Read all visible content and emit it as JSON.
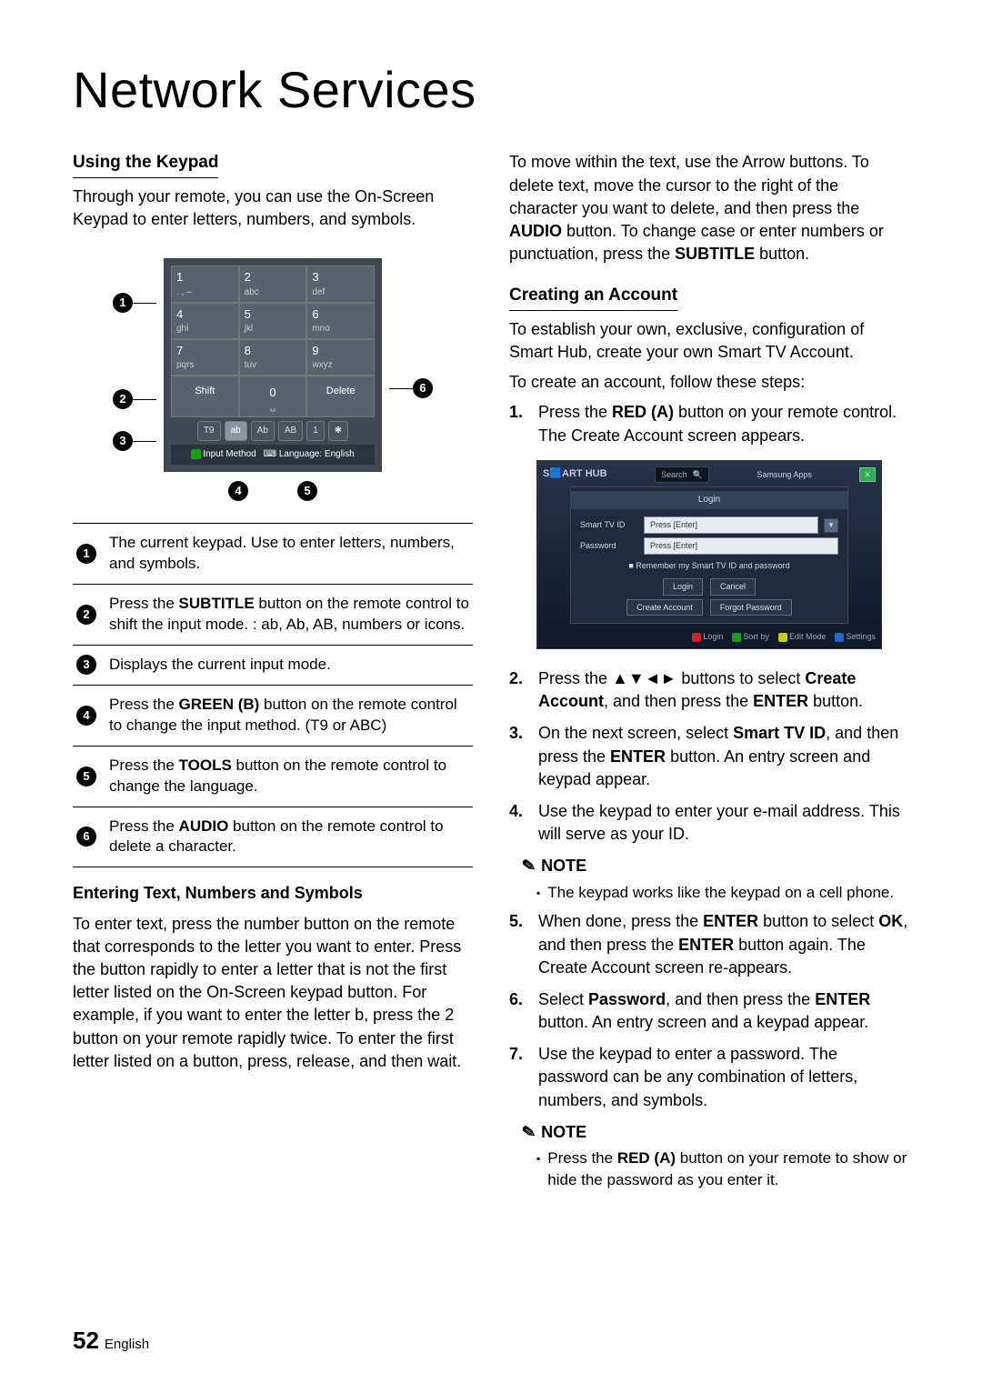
{
  "title": "Network Services",
  "left": {
    "h_using": "Using the Keypad",
    "p_using": "Through your remote, you can use the On-Screen Keypad to enter letters, numbers, and symbols.",
    "keypad": {
      "rows": [
        [
          {
            "n": "1",
            "l": ". , –"
          },
          {
            "n": "2",
            "l": "abc"
          },
          {
            "n": "3",
            "l": "def"
          }
        ],
        [
          {
            "n": "4",
            "l": "ghi"
          },
          {
            "n": "5",
            "l": "jkl"
          },
          {
            "n": "6",
            "l": "mno"
          }
        ],
        [
          {
            "n": "7",
            "l": "pqrs"
          },
          {
            "n": "8",
            "l": "tuv"
          },
          {
            "n": "9",
            "l": "wxyz"
          }
        ]
      ],
      "shift": "Shift",
      "zero": "0",
      "space": "␣",
      "delete": "Delete",
      "t9": "T9",
      "modes": [
        "ab",
        "Ab",
        "AB",
        "1",
        "✱"
      ],
      "footer_input": "Input Method",
      "footer_lang": "Language: English"
    },
    "legend": {
      "1": "The current keypad.\nUse to enter letters, numbers, and symbols.",
      "2_pre": "Press the ",
      "2_b": "SUBTITLE",
      "2_post": " button on the remote control to shift the input mode.\n: ab, Ab, AB, numbers or icons.",
      "3": "Displays the current input mode.",
      "4_pre": "Press the ",
      "4_b": "GREEN (B)",
      "4_post": " button on the remote control to change the input method. (T9 or ABC)",
      "5_pre": "Press the ",
      "5_b": "TOOLS",
      "5_post": " button on the remote control to change the language.",
      "6_pre": "Press the ",
      "6_b": "AUDIO",
      "6_post": " button on the remote control to delete a character."
    },
    "h_entering": "Entering Text, Numbers and Symbols",
    "p_entering": "To enter text, press the number button on the remote that corresponds to the letter you want to enter. Press the button rapidly to enter a letter that is not the first letter listed on the On-Screen keypad button. For example, if you want to enter the letter b, press the 2 button on your remote rapidly twice. To enter the first letter listed on a button, press, release, and then wait."
  },
  "right": {
    "p_move_pre": "To move within the text, use the Arrow buttons. To delete text, move the cursor to the right of the character you want to delete, and then press the ",
    "audio": "AUDIO",
    "p_move_mid": " button. To change case or enter numbers or punctuation, press the ",
    "subtitle": "SUBTITLE",
    "p_move_post": " button.",
    "h_creating": "Creating an Account",
    "p_est": "To establish your own, exclusive, configuration of Smart Hub, create your own Smart TV Account.",
    "p_follow": "To create an account, follow these steps:",
    "step1_pre": "Press the ",
    "step1_b": "RED (A)",
    "step1_post": " button on your remote control. The Create Account screen appears.",
    "ss": {
      "logo": "S🟦ART HUB",
      "search": "Search",
      "apps": "Samsung Apps",
      "panel_title": "Login",
      "id_label": "Smart TV ID",
      "id_ph": "Press [Enter]",
      "pw_label": "Password",
      "pw_ph": "Press [Enter]",
      "remember": "Remember my Smart TV ID and password",
      "btn_login": "Login",
      "btn_cancel": "Cancel",
      "btn_create": "Create Account",
      "btn_forgot": "Forgot Password",
      "bb_a": "Login",
      "bb_b": "Sort by",
      "bb_c": "Edit Mode",
      "bb_d": "Settings"
    },
    "step2_pre": "Press the ",
    "step2_arrows": "▲▼◄►",
    "step2_mid": " buttons to select ",
    "step2_b1": "Create Account",
    "step2_mid2": ", and then press the ",
    "step2_b2": "ENTER",
    "step2_post": " button.",
    "step3_pre": "On the next screen, select ",
    "step3_b1": "Smart TV ID",
    "step3_mid": ", and then press the ",
    "step3_b2": "ENTER",
    "step3_post": " button.\nAn entry screen and keypad appear.",
    "step4": "Use the keypad to enter your e-mail address. This will serve as your ID.",
    "note": "NOTE",
    "note1": "The keypad works like the keypad on a cell phone.",
    "step5_pre": "When done, press the ",
    "step5_b1": "ENTER",
    "step5_mid": " button to select ",
    "step5_b2": "OK",
    "step5_mid2": ", and then press the ",
    "step5_b3": "ENTER",
    "step5_post": " button again. The Create Account screen re-appears.",
    "step6_pre": "Select ",
    "step6_b1": "Password",
    "step6_mid": ", and then press the ",
    "step6_b2": "ENTER",
    "step6_post": " button. An entry screen and a keypad appear.",
    "step7": "Use the keypad to enter a password. The password can be any combination of letters, numbers, and symbols.",
    "note2_pre": "Press the ",
    "note2_b": "RED (A)",
    "note2_post": " button on your remote to show or hide the password as you enter it."
  },
  "footer": {
    "page": "52",
    "lang": "English"
  }
}
